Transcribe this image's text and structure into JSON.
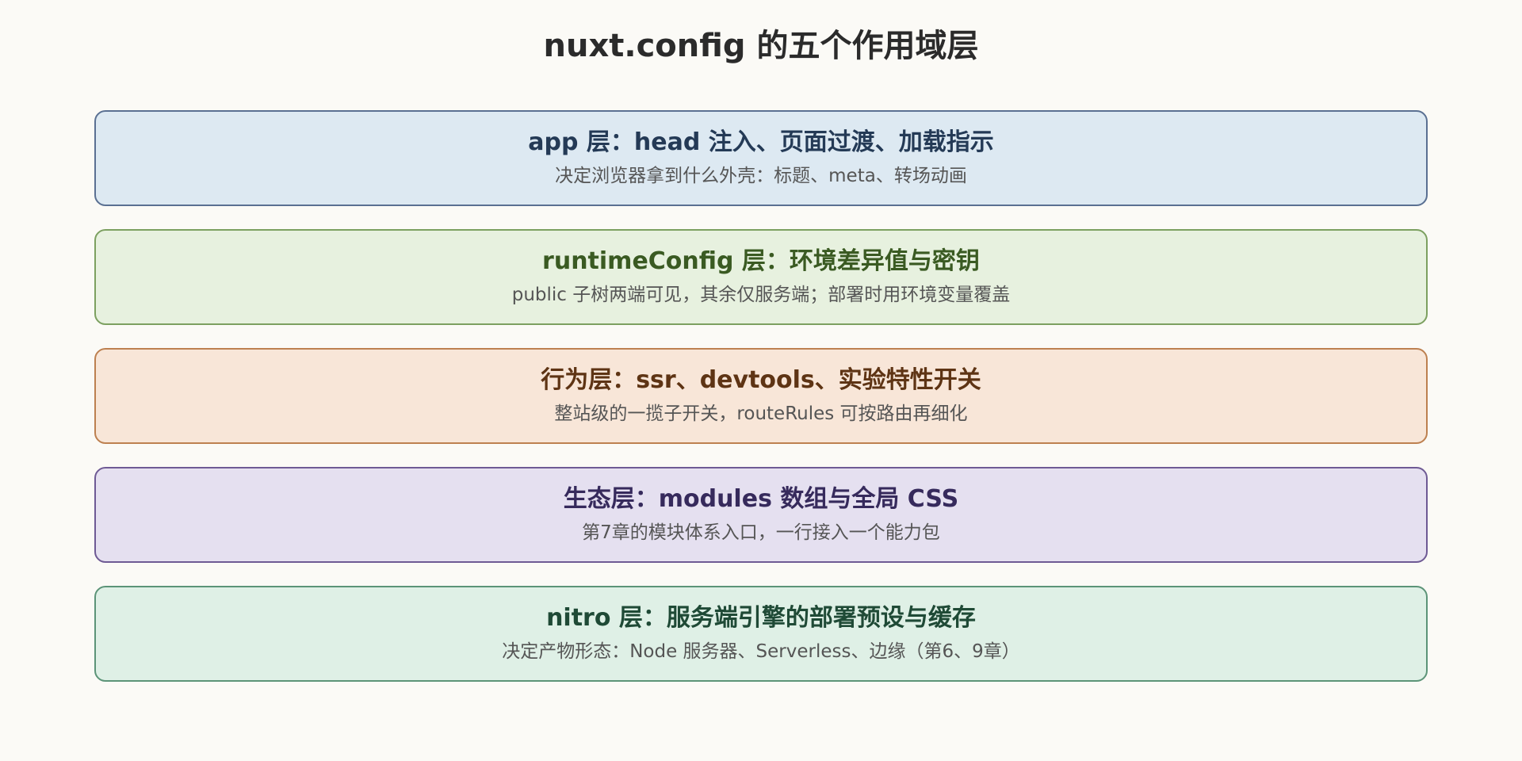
{
  "title": "nuxt.config 的五个作用域层",
  "layers": [
    {
      "title": "app 层：head 注入、页面过渡、加载指示",
      "desc": "决定浏览器拿到什么外壳：标题、meta、转场动画",
      "bg": "#dde9f2",
      "border": "#5a7092",
      "text": "#243a56"
    },
    {
      "title": "runtimeConfig 层：环境差异值与密钥",
      "desc": "public 子树两端可见，其余仅服务端；部署时用环境变量覆盖",
      "bg": "#e7f1df",
      "border": "#7ca060",
      "text": "#3a5a22"
    },
    {
      "title": "行为层：ssr、devtools、实验特性开关",
      "desc": "整站级的一揽子开关，routeRules 可按路由再细化",
      "bg": "#f8e6d8",
      "border": "#bd8050",
      "text": "#5e3414"
    },
    {
      "title": "生态层：modules 数组与全局 CSS",
      "desc": "第7章的模块体系入口，一行接入一个能力包",
      "bg": "#e5e0f0",
      "border": "#6e5a94",
      "text": "#362a5c"
    },
    {
      "title": "nitro 层：服务端引擎的部署预设与缓存",
      "desc": "决定产物形态：Node 服务器、Serverless、边缘（第6、9章）",
      "bg": "#dff0e6",
      "border": "#5c9478",
      "text": "#1f4a36"
    }
  ]
}
